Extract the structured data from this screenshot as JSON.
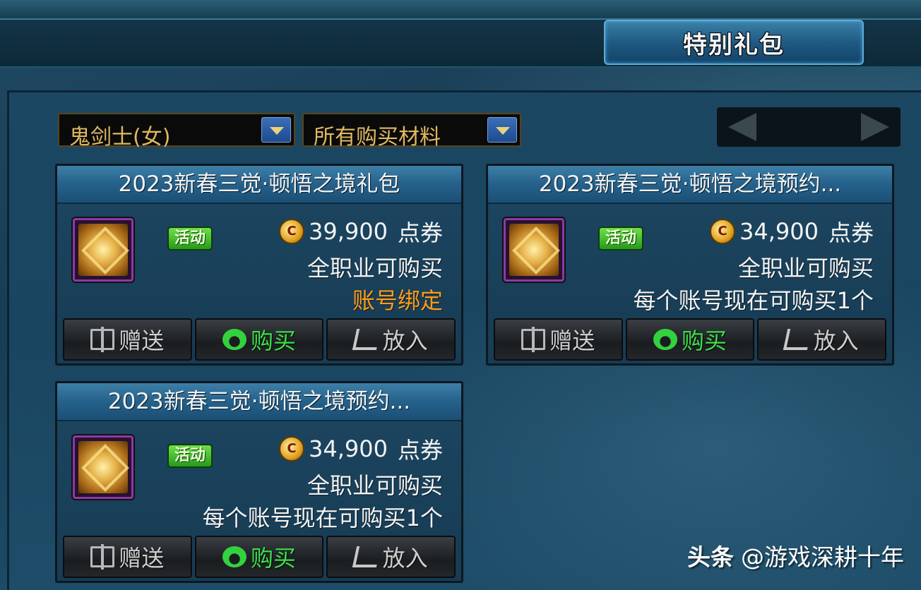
{
  "top": {
    "tab_label": "特别礼包"
  },
  "filters": {
    "character": "鬼剑士(女)",
    "material": "所有购买材料"
  },
  "items": [
    {
      "title": "2023新春三觉·顿悟之境礼包",
      "badge": "活动",
      "price": "39,900",
      "currency": "点券",
      "line1": "全职业可购买",
      "line2": "账号绑定",
      "line2_color": "#ff9c1a",
      "gift_label": "赠送",
      "buy_label": "购买",
      "cart_label": "放入"
    },
    {
      "title": "2023新春三觉·顿悟之境预约...",
      "badge": "活动",
      "price": "34,900",
      "currency": "点券",
      "line1": "全职业可购买",
      "line2": "每个账号现在可购买1个",
      "gift_label": "赠送",
      "buy_label": "购买",
      "cart_label": "放入"
    },
    {
      "title": "2023新春三觉·顿悟之境预约...",
      "badge": "活动",
      "price": "34,900",
      "currency": "点券",
      "line1": "全职业可购买",
      "line2": "每个账号现在可购买1个",
      "gift_label": "赠送",
      "buy_label": "购买",
      "cart_label": "放入"
    }
  ],
  "watermark": {
    "brand": "头条",
    "handle": "@游戏深耕十年"
  }
}
